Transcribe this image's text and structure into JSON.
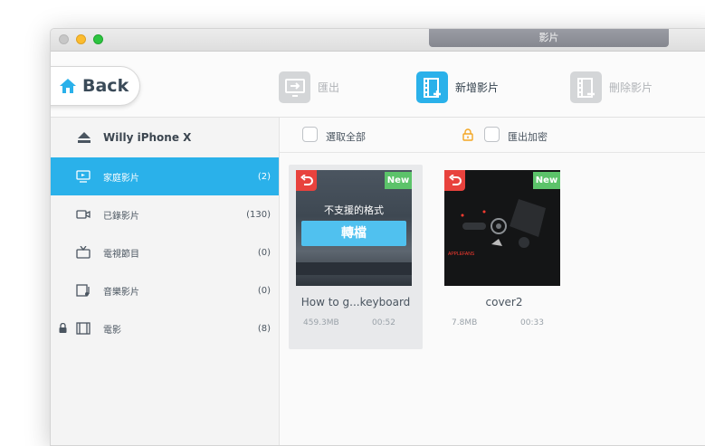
{
  "window": {
    "title": "影片"
  },
  "toolbar": {
    "back_label": "Back",
    "export_label": "匯出",
    "add_label": "新增影片",
    "delete_label": "刪除影片"
  },
  "sidebar": {
    "device_name": "Willy  iPhone X",
    "items": [
      {
        "label": "家庭影片",
        "count": "(2)",
        "icon": "tv-icon",
        "active": true
      },
      {
        "label": "已錄影片",
        "count": "(130)",
        "icon": "video-camera-icon"
      },
      {
        "label": "電視節目",
        "count": "(0)",
        "icon": "television-icon"
      },
      {
        "label": "音樂影片",
        "count": "(0)",
        "icon": "music-video-icon"
      },
      {
        "label": "電影",
        "count": "(8)",
        "icon": "film-icon",
        "locked": true
      }
    ]
  },
  "content": {
    "select_all_label": "選取全部",
    "encrypt_label": "匯出加密",
    "videos": [
      {
        "name": "How to g...keyboard",
        "size": "459.3MB",
        "duration": "00:52",
        "badge": "New",
        "unsupported_text": "不支援的格式",
        "convert_label": "轉檔"
      },
      {
        "name": "cover2",
        "size": "7.8MB",
        "duration": "00:33",
        "badge": "New"
      }
    ]
  },
  "colors": {
    "accent": "#2ab1ea",
    "new_badge": "#5cc36a",
    "redo_badge": "#e8423d"
  }
}
